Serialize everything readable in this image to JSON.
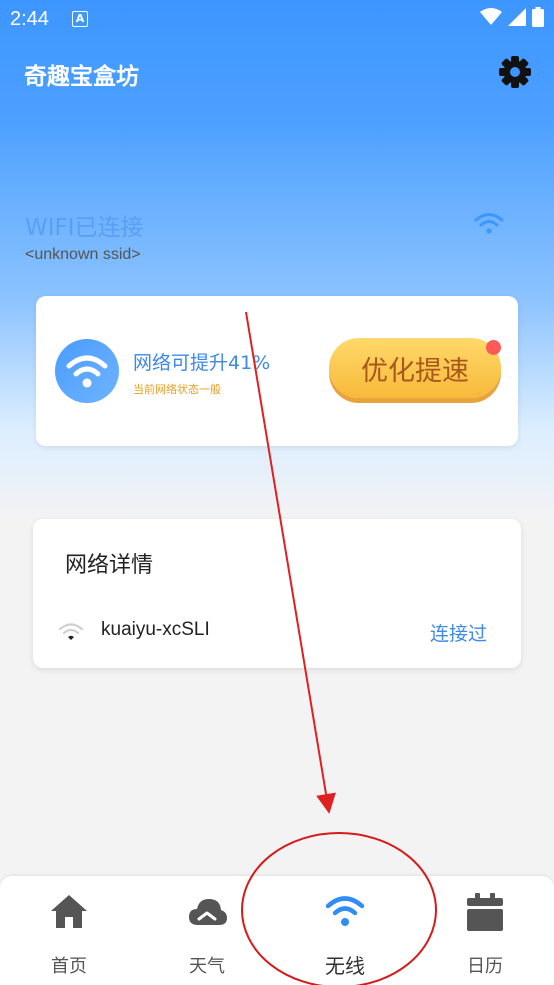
{
  "status_bar": {
    "time": "2:44",
    "notif_letter": "A"
  },
  "app": {
    "title": "奇趣宝盒坊"
  },
  "wifi": {
    "status": "WIFI已连接",
    "ssid": "<unknown ssid>"
  },
  "boost_card": {
    "title": "网络可提升41%",
    "subtitle": "当前网络状态一般",
    "button_label": "优化提速"
  },
  "details_card": {
    "title": "网络详情",
    "networks": [
      {
        "name": "kuaiyu-xcSLI",
        "status": "连接过"
      }
    ]
  },
  "nav": {
    "active": "无线",
    "items": [
      {
        "label": "首页",
        "icon": "home-icon"
      },
      {
        "label": "天气",
        "icon": "cloud-icon"
      },
      {
        "label": "无线",
        "icon": "wifi-icon"
      },
      {
        "label": "日历",
        "icon": "calendar-icon"
      }
    ]
  },
  "colors": {
    "primary": "#3d96ff",
    "accent_orange": "#f7b93a",
    "link_blue": "#3e8ae6",
    "annotation_red": "#e02020"
  }
}
